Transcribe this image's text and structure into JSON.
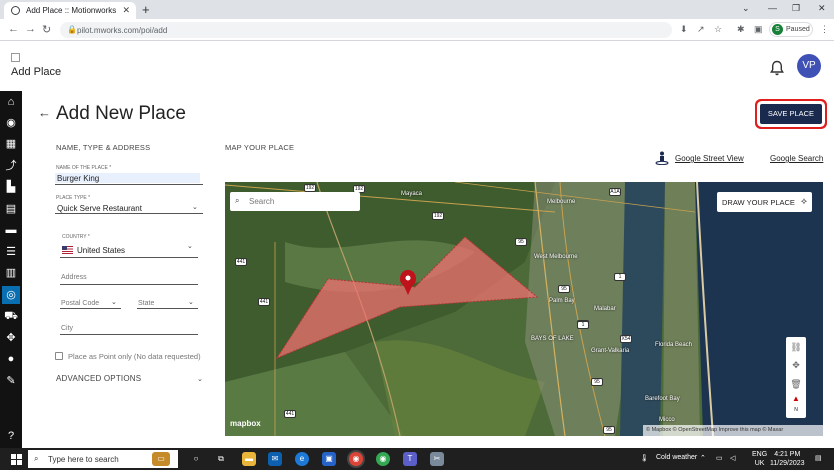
{
  "browser": {
    "tab_title": "Add Place :: Motionworks",
    "url_host": "pilot.mworks.com",
    "url_path": "/poi/add",
    "profile_initial": "S",
    "profile_status": "Paused"
  },
  "header": {
    "app_label": "Add Place",
    "avatar_initials": "VP"
  },
  "page": {
    "title": "Add New Place",
    "save_button": "SAVE PLACE"
  },
  "form": {
    "section_title": "NAME, TYPE & ADDRESS",
    "name_label": "NAME OF THE PLACE *",
    "name_value": "Burger King",
    "type_label": "PLACE TYPE *",
    "type_value": "Quick Serve Restaurant",
    "country_label": "COUNTRY *",
    "country_value": "United States",
    "address_placeholder": "Address",
    "postal_placeholder": "Postal Code",
    "state_placeholder": "State",
    "city_placeholder": "City",
    "point_only_label": "Place as Point only (No data requested)",
    "advanced_label": "ADVANCED OPTIONS"
  },
  "map": {
    "section_title": "MAP YOUR PLACE",
    "street_view_link": "Google Street View",
    "google_search_link": "Google Search",
    "search_placeholder": "Search",
    "draw_button": "DRAW YOUR PLACE",
    "logo_text": "mapbox",
    "attribution": "© Mapbox © OpenStreetMap Improve this map © Maxar",
    "place_labels": [
      "Mayaca",
      "Melbourne",
      "West Melbourne",
      "Palm Bay",
      "Malabar",
      "BAYS OF LAKE",
      "Grant-Valkaria",
      "Florida Beach",
      "Barefoot Bay",
      "Micco"
    ],
    "road_shields": [
      "192",
      "192",
      "A1A",
      "192",
      "441",
      "95",
      "95",
      "1",
      "441",
      "95",
      "1",
      "X54",
      "95",
      "441",
      "95"
    ],
    "polygon_color": "#f07070"
  },
  "taskbar": {
    "search_placeholder": "Type here to search",
    "weather": "Cold weather",
    "lang_top": "ENG",
    "lang_bottom": "UK",
    "time": "4:21 PM",
    "date": "11/29/2023"
  }
}
